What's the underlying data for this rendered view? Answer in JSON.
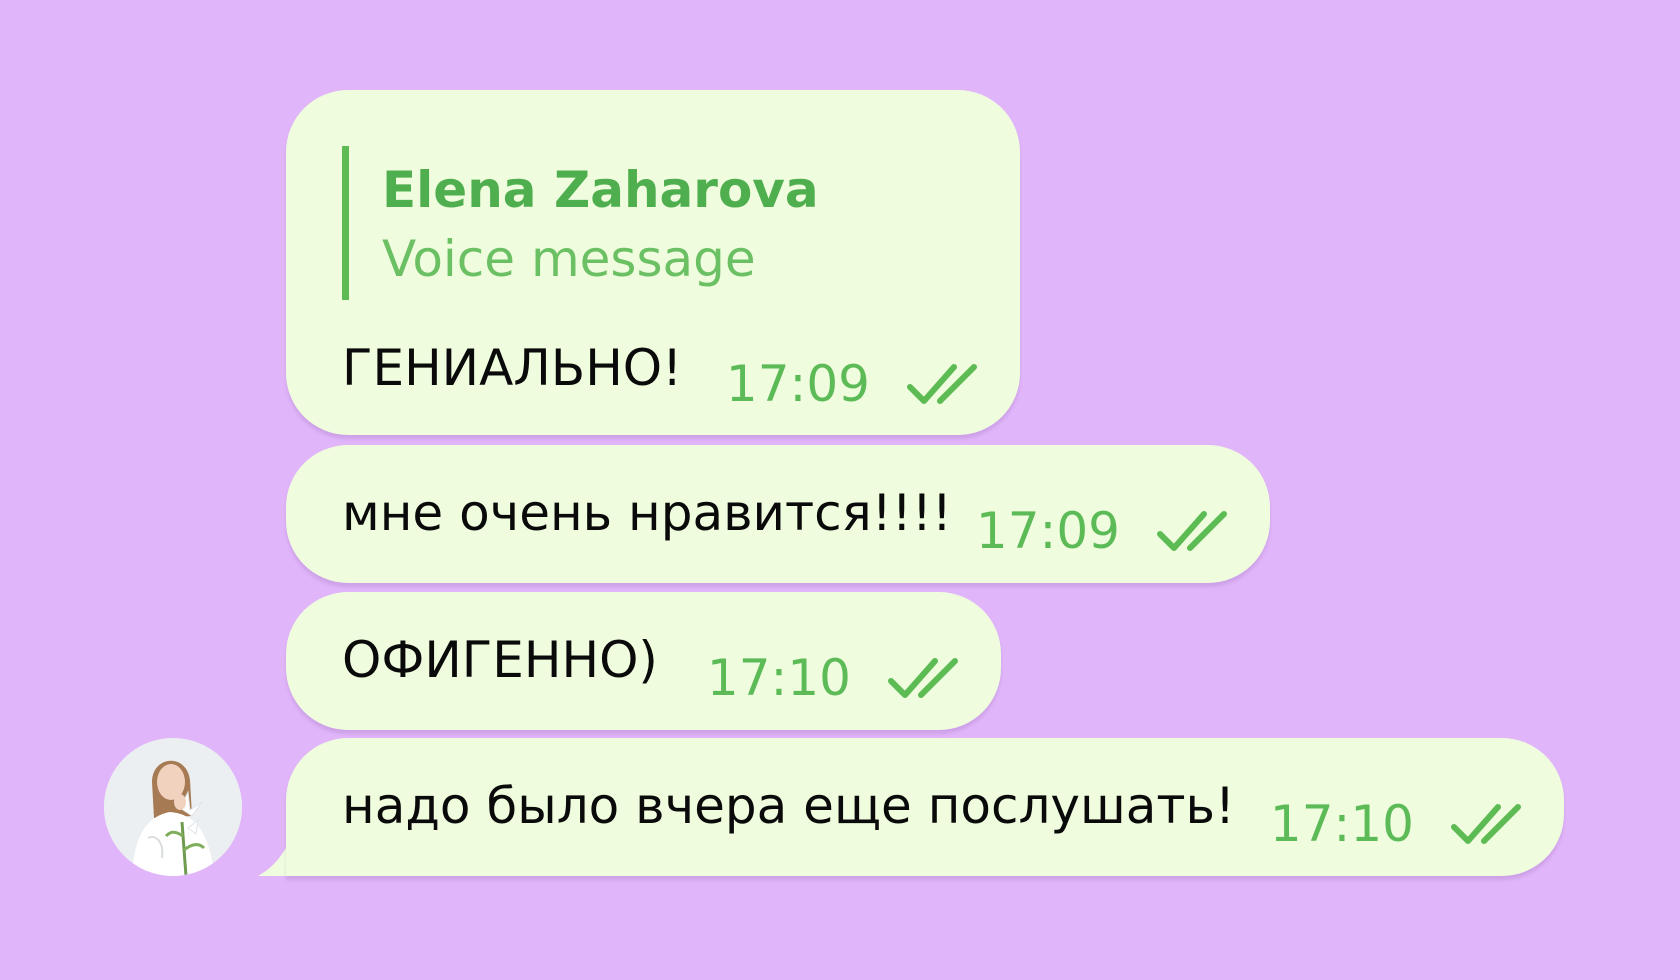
{
  "chat": {
    "messages": [
      {
        "reply": {
          "name": "Elena Zaharova",
          "preview": "Voice message"
        },
        "text": "ГЕНИАЛЬНО!",
        "time": "17:09",
        "status_icon": "double-check-icon"
      },
      {
        "text": "мне очень нравится!!!!",
        "time": "17:09",
        "status_icon": "double-check-icon"
      },
      {
        "text": "ОФИГЕННО)",
        "time": "17:10",
        "status_icon": "double-check-icon"
      },
      {
        "text": "надо было вчера еще послушать!",
        "time": "17:10",
        "status_icon": "double-check-icon"
      }
    ]
  },
  "colors": {
    "background": "#e1b5fa",
    "bubble": "#effdde",
    "accent_green": "#5cbb53",
    "text": "#0a0a0a"
  }
}
